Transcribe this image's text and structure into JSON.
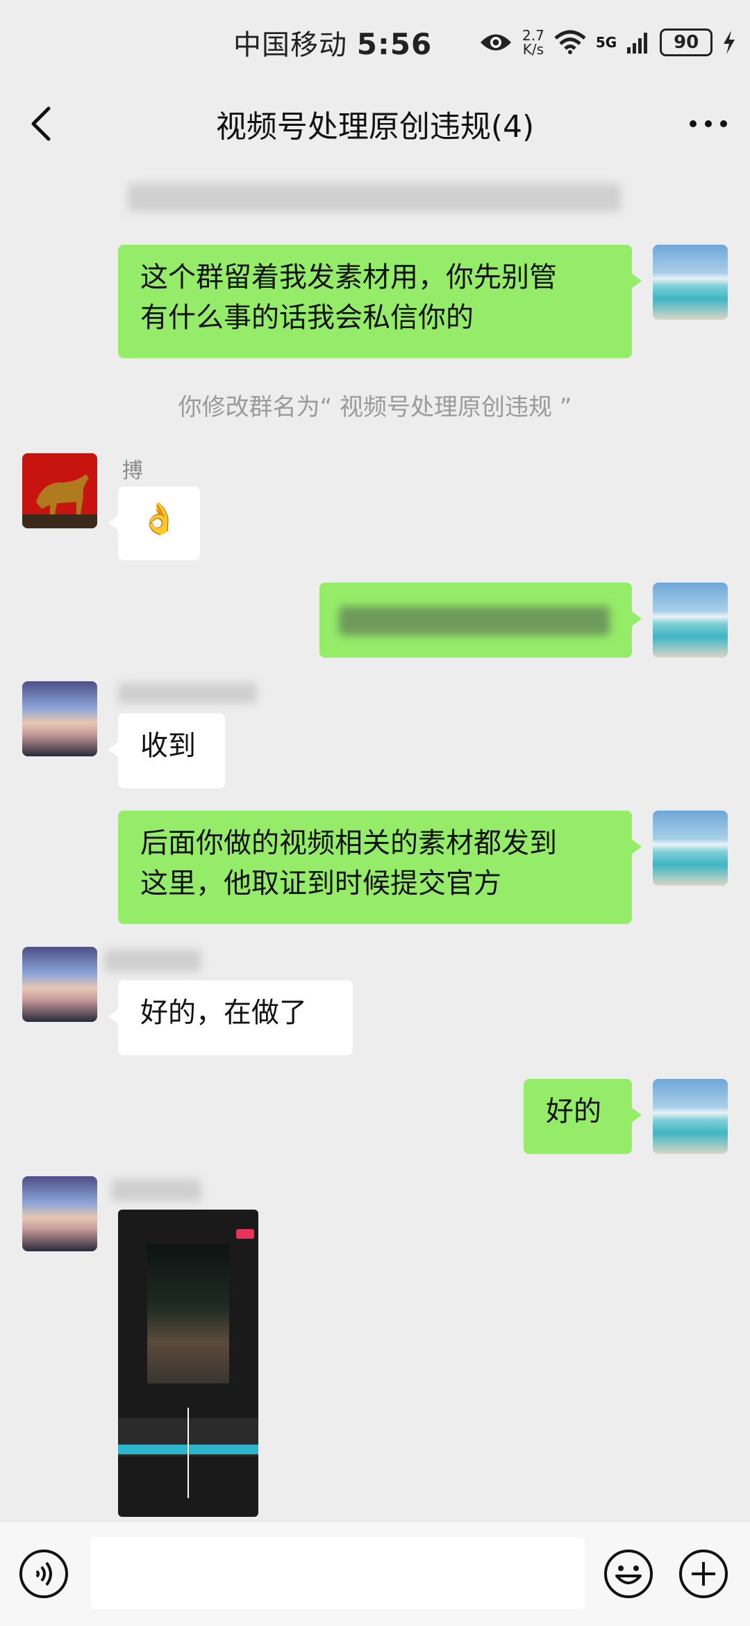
{
  "status_bar": {
    "carrier": "中国移动",
    "time": "5:56",
    "net_speed_value": "2.7",
    "net_speed_unit": "K/s",
    "signal_label": "5G",
    "battery": "90"
  },
  "nav": {
    "title": "视频号处理原创违规(4)"
  },
  "messages": {
    "m1_line1": "这个群留着我发素材用，你先别管",
    "m1_line2": "有什么事的话我会私信你的",
    "system_notice": "你修改群名为“ 视频号处理原创违规 ”",
    "sender_bo": "搏",
    "ok_emoji": "👌",
    "m_received": "收到",
    "m3_line1": "后面你做的视频相关的素材都发到",
    "m3_line2": "这里，他取证到时候提交官方",
    "m_working": "好的，在做了",
    "m_ok": "好的"
  },
  "input": {
    "placeholder": ""
  }
}
